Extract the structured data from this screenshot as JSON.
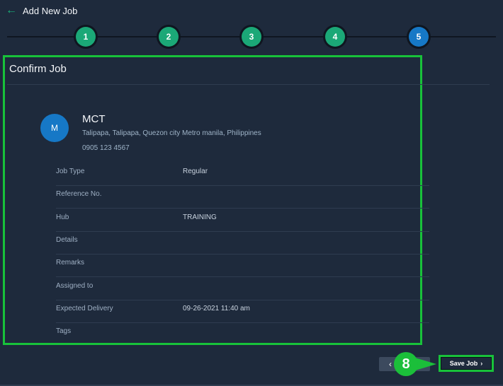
{
  "header": {
    "back_icon": "arrow-left-icon",
    "title": "Add New Job"
  },
  "stepper": {
    "steps": [
      "1",
      "2",
      "3",
      "4",
      "5"
    ],
    "active_index": 4
  },
  "card": {
    "title": "Confirm Job",
    "company": {
      "avatar_letter": "M",
      "name": "MCT",
      "address": "Talipapa, Talipapa, Quezon city Metro manila, Philippines",
      "phone": "0905 123 4567"
    },
    "details": [
      {
        "label": "Job Type",
        "value": "Regular"
      },
      {
        "label": "Reference No.",
        "value": ""
      },
      {
        "label": "Hub",
        "value": "TRAINING"
      },
      {
        "label": "Details",
        "value": ""
      },
      {
        "label": "Remarks",
        "value": ""
      },
      {
        "label": "Assigned to",
        "value": ""
      },
      {
        "label": "Expected Delivery",
        "value": "09-26-2021 11:40 am"
      },
      {
        "label": "Tags",
        "value": ""
      }
    ]
  },
  "footer": {
    "prev_label": "‹",
    "callout_number": "8",
    "save_label": "Save Job",
    "save_icon": "chevron-right-icon"
  },
  "colors": {
    "accent_green": "#1ba877",
    "active_blue": "#1678c6",
    "highlight_green": "#18c23a",
    "background": "#1e2a3c"
  }
}
